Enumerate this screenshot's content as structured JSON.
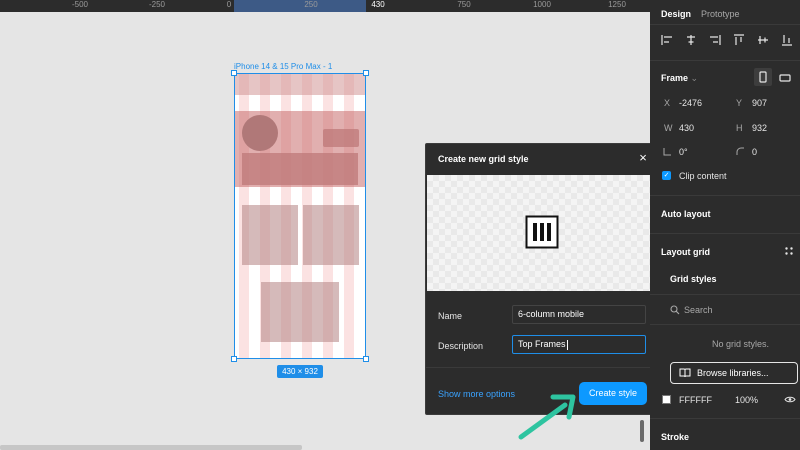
{
  "ruler": {
    "ticks": [
      "-500",
      "-250",
      "0",
      "250",
      "430",
      "750",
      "1000",
      "1250"
    ]
  },
  "canvas": {
    "frame_label": "iPhone 14 & 15 Pro Max - 1",
    "size_badge": "430 × 932"
  },
  "dialog": {
    "title": "Create new grid style",
    "close_icon": "×",
    "name_label": "Name",
    "name_value": "6-column mobile",
    "description_label": "Description",
    "description_value": "Top Frames",
    "more_options": "Show more options",
    "create_button": "Create style",
    "preview_icon": "grid-columns-icon"
  },
  "panel": {
    "tabs": [
      "Design",
      "Prototype"
    ],
    "frame_section": "Frame",
    "x_label": "X",
    "x_value": "-2476",
    "y_label": "Y",
    "y_value": "907",
    "w_label": "W",
    "w_value": "430",
    "h_label": "H",
    "h_value": "932",
    "rotation_value": "0°",
    "radius_value": "0",
    "clip_content": "Clip content",
    "auto_layout": "Auto layout",
    "layout_grid": "Layout grid",
    "grid_styles": "Grid styles",
    "search_placeholder": "Search",
    "no_styles": "No grid styles.",
    "browse_libraries": "Browse libraries...",
    "fill_hex": "FFFFFF",
    "fill_opacity": "100%",
    "stroke": "Stroke"
  },
  "colors": {
    "accent": "#0d99ff",
    "selection": "#1f8ee8",
    "panel_bg": "#2c2c2c",
    "canvas_bg": "#e5e5e5",
    "arrow": "#2ec4a0"
  }
}
